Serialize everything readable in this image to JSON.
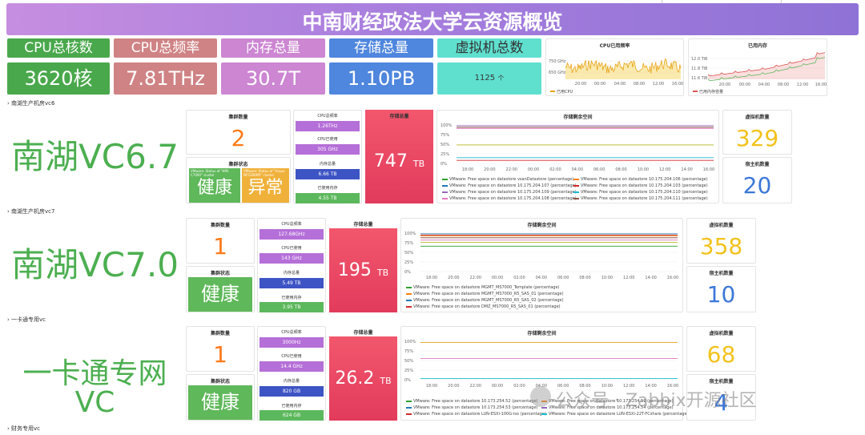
{
  "header": {
    "title": "中南财经政法大学云资源概览"
  },
  "summary": {
    "cpu_cores": {
      "label": "CPU总核数",
      "value": "3620核"
    },
    "cpu_freq": {
      "label": "CPU总频率",
      "value": "7.81THz"
    },
    "memory": {
      "label": "内存总量",
      "value": "30.7T"
    },
    "storage": {
      "label": "存储总量",
      "value": "1.10PB"
    },
    "vms": {
      "label": "虚拟机总数",
      "value": "1125",
      "unit": "个"
    }
  },
  "cpu_chart": {
    "title": "CPU已用频率",
    "y_ticks": [
      "750 GHz",
      "650 GHz"
    ],
    "x_ticks": [
      "20:00",
      "00:00",
      "04:00",
      "08:00",
      "12:00",
      "16:00"
    ],
    "legend": "已用CPU"
  },
  "mem_chart": {
    "title": "已用内存",
    "y_ticks": [
      "12.0 TiB",
      "11.8 TiB",
      "11.6 TiB"
    ],
    "x_ticks": [
      "20:00",
      "00:00",
      "04:00",
      "08:00",
      "12:00",
      "16:00"
    ],
    "legend": "已用内存容量"
  },
  "labels": {
    "cluster_count": "集群数量",
    "cluster_status": "集群状态",
    "cpu_total": "CPU总频率",
    "cpu_used": "CPU已使用",
    "mem_total": "内存总量",
    "mem_used": "已使用内存",
    "storage_total": "存储总量",
    "storage_free": "存储剩余空间",
    "vm_count": "虚拟机数量",
    "host_count": "宿主机数量"
  },
  "storage_x_ticks": [
    "18:00",
    "20:00",
    "22:00",
    "00:00",
    "02:00",
    "04:00",
    "06:00",
    "08:00",
    "10:00",
    "12:00",
    "14:00",
    "16:00"
  ],
  "storage_y_ticks": [
    "100%",
    "75%",
    "50%",
    "25%",
    "0%"
  ],
  "sections": [
    {
      "header": "南湖生产机房vc6",
      "name": "南湖VC6.7",
      "clusters": "2",
      "status1": "健康",
      "status2": "异常",
      "status1_note": "VMware: Status of \"HPE C7000\" cluster",
      "status2_note": "VMware: Status of \"Inspur NF5280M5\" cluster",
      "cpu_total": "1.26THz",
      "cpu_used": "305 GHz",
      "mem_total": "6.66 TB",
      "mem_used": "4.55 TB",
      "storage_value": "747",
      "storage_unit": "TB",
      "vms": "329",
      "hosts": "20",
      "legend": [
        "VMware: Free space on datastore vsanDatastore (percentage)",
        "VMware: Free space on datastore 10.175.204.107 (percentage)",
        "VMware: Free space on datastore 10.175.204.109 (percentage)",
        "VMware: Free space on datastore 10.175.204.108 (percentage)",
        "VMware: Free space on datastore 10.175.204.106 (percentage)",
        "VMware: Free space on datastore 10.175.204.103 (percentage)",
        "VMware: Free space on datastore 10.175.204.110 (percentage)",
        "VMware: Free space on datastore 10.175.204.111 (percentage)"
      ]
    },
    {
      "header": "南湖生产机房vc7",
      "name": "南湖VC7.0",
      "clusters": "1",
      "status1": "健康",
      "cpu_total": "127.68GHz",
      "cpu_used": "143 GHz",
      "mem_total": "5.49 TB",
      "mem_used": "3.95 TB",
      "storage_value": "195",
      "storage_unit": "TB",
      "vms": "358",
      "hosts": "10",
      "legend": [
        "VMware: Free space on datastore MGMT_MS7000_Template (percentage)",
        "VMware: Free space on datastore MGMT_MS7000_R5_SAS_01 (percentage)",
        "VMware: Free space on datastore MGMT_MS7000_R5_SAS_02 (percentage)",
        "VMware: Free space on datastore DMZ_MS7000_R5_SAS_01 (percentage)"
      ]
    },
    {
      "header": "一卡通专用vc",
      "name": "一卡通专网VC",
      "clusters": "1",
      "status1": "健康",
      "cpu_total": "3000Hz",
      "cpu_used": "14.4 GHz",
      "mem_total": "820 GB",
      "mem_used": "624 GB",
      "storage_value": "26.2",
      "storage_unit": "TB",
      "vms": "68",
      "hosts": "4",
      "legend": [
        "VMware: Free space on datastore 10.173.254.52 (percentage)",
        "VMware: Free space on datastore 10.173.254.53 (percentage)",
        "VMware: Free space on datastore LUN-ESXi-100G-iso (percentage)",
        "VMware: Free space on datastore 10.173.254.51 (percentage)",
        "VMware: Free space on datastore 10.173.254.54 (percentage)",
        "VMware: Free space on datastore LUN-ESXi-22T-FCshare (percentage)"
      ]
    },
    {
      "header": "财务专用vc"
    }
  ],
  "watermark": "公众号 · Zabbix开源社区"
}
